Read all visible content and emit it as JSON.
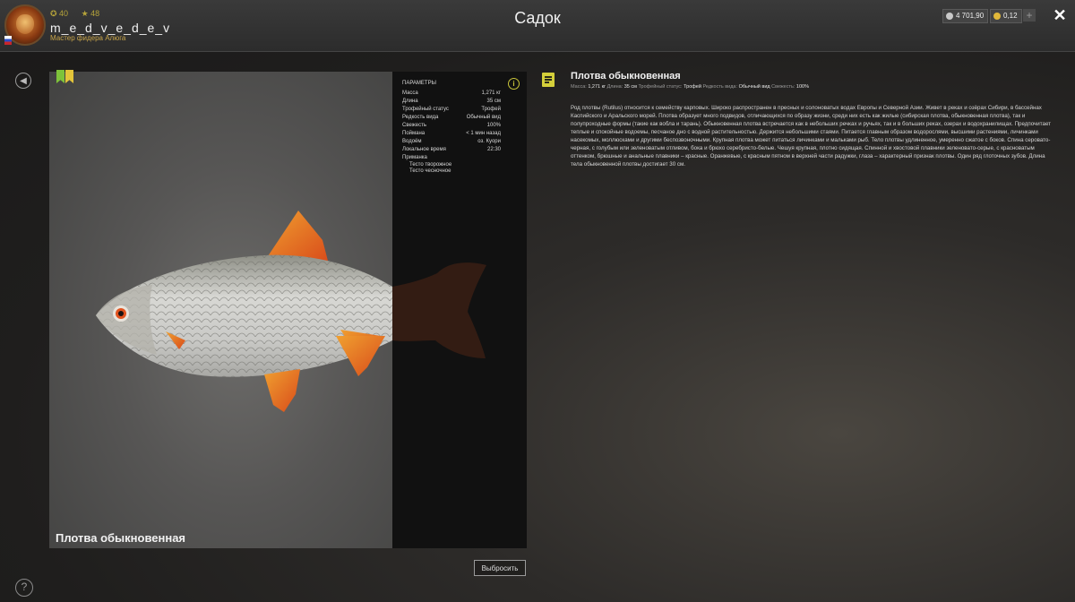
{
  "header": {
    "title": "Садок",
    "user": {
      "name": "m_e_d_v_e_d_e_v",
      "rank": "Мастер фидера Алюга",
      "stat_a": "40",
      "stat_b": "48"
    },
    "currency": {
      "silver": "4 701,90",
      "gold": "0,12"
    },
    "plus_label": "+",
    "close_label": "✕"
  },
  "fish_view": {
    "name": "Плотва обыкновенная"
  },
  "params": {
    "title": "ПАРАМЕТРЫ",
    "rows": [
      {
        "label": "Масса",
        "value": "1,271 кг"
      },
      {
        "label": "Длина",
        "value": "35 см"
      },
      {
        "label": "Трофейный статус",
        "value": "Трофей"
      },
      {
        "label": "Редкость вида",
        "value": "Обычный вид"
      },
      {
        "label": "Свежесть",
        "value": "100%"
      },
      {
        "label": "Поймана",
        "value": "< 1 мин назад"
      },
      {
        "label": "Водоём",
        "value": "оз. Куори"
      },
      {
        "label": "Локальное время",
        "value": "22:30"
      },
      {
        "label": "Приманка",
        "value": ""
      }
    ],
    "baits": [
      "Тесто творожное",
      "Тесто чесночное"
    ]
  },
  "release_button": "Выбросить",
  "description": {
    "title": "Плотва обыкновенная",
    "meta": {
      "mass_label": "Масса:",
      "mass": "1,271 кг",
      "length_label": "Длина:",
      "length": "35 см",
      "trophy_label": "Трофейный статус:",
      "trophy": "Трофей",
      "rarity_label": "Редкость вида:",
      "rarity": "Обычный вид",
      "fresh_label": "Свежесть:",
      "fresh": "100%"
    },
    "text": "Род плотвы (Rutilus) относится к семейству карповых. Широко распространен в пресных и солоноватых водах Европы и Северной Азии. Живет в реках и озёрах Сибири, в бассейнах Каспийского и Аральского морей. Плотва образует много подвидов, отличающихся по образу жизни, среди них есть как жилые (сибирская плотва, обыкновенная плотва), так и полупроходные формы (такие как вобла и тарань). Обыкновенная плотва встречается как в небольших речках и ручьях, так и в больших реках, озерах и водохранилищах. Предпочитает теплые и спокойные водоемы, песчаное дно с водной растительностью. Держится небольшими стаями. Питается главным образом водорослями, высшими растениями, личинками насекомых, моллюсками и другими беспозвоночными. Крупная плотва может питаться личинками и мальками рыб. Тело плотвы удлиненное, умеренно сжатое с боков. Спина серовато-черная, с голубым или зеленоватым отливом, бока и брюхо серебристо-белые. Чешуя крупная, плотно сидящая. Спинной и хвостовой плавники зеленовато-серые, с красноватым оттенком, брюшные и анальные плавники – красные. Оранжевые, с красным пятном в верхней части радужки, глаза – характерный признак плотвы. Один ряд глоточных зубов. Длина тела обыкновенной плотвы достигает 30 см."
  },
  "icons": {
    "back": "back-arrow-icon",
    "help": "help-icon",
    "info": "info-icon",
    "note": "note-icon"
  }
}
